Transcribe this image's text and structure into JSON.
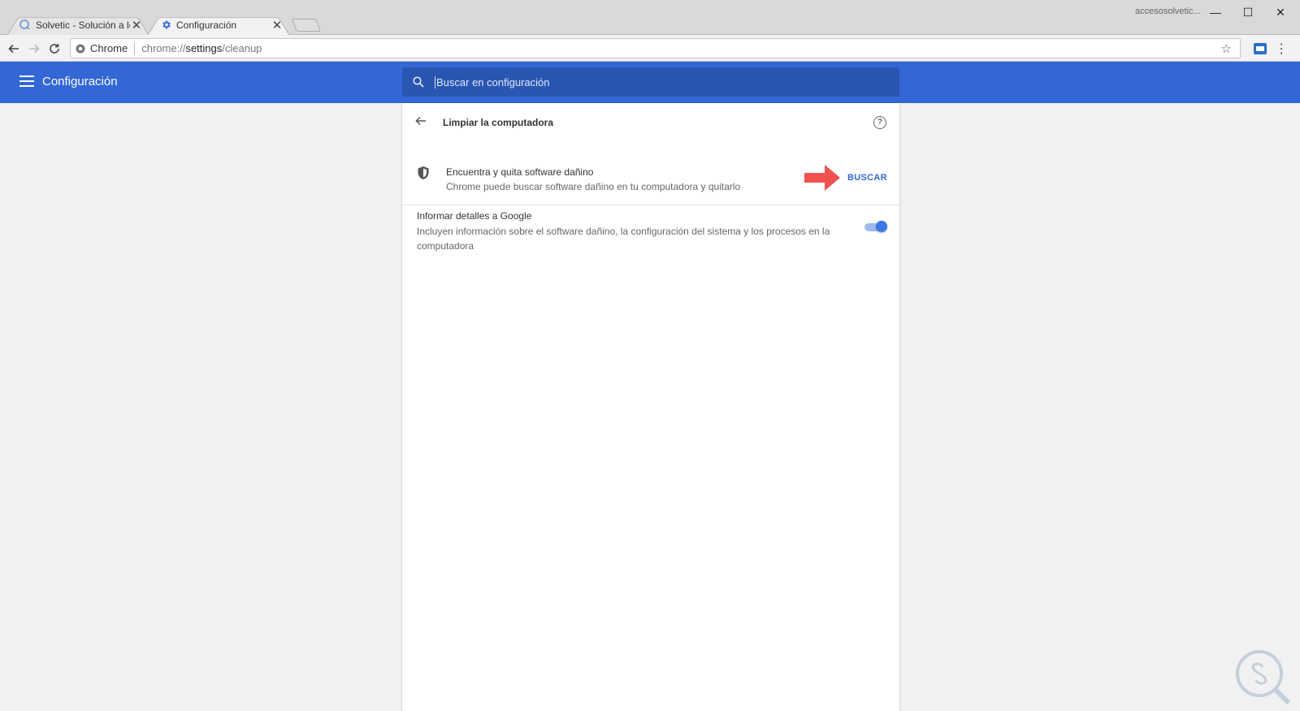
{
  "tabs": [
    {
      "title": "Solvetic - Solución a los p",
      "active": false,
      "favicon": "solvetic-icon"
    },
    {
      "title": "Configuración",
      "active": true,
      "favicon": "gear-icon"
    }
  ],
  "window": {
    "profile": "accesosolvetic..."
  },
  "omnibox": {
    "site_label": "Chrome",
    "url_prefix": "chrome://",
    "url_host": "settings",
    "url_path": "/cleanup"
  },
  "header": {
    "title": "Configuración",
    "search_placeholder": "Buscar en configuración"
  },
  "cleanup": {
    "title": "Limpiar la computadora",
    "scan": {
      "title": "Encuentra y quita software dañino",
      "subtitle": "Chrome puede buscar software dañino en tu computadora y quitarlo",
      "button": "BUSCAR"
    },
    "report": {
      "title": "Informar detalles a Google",
      "subtitle": "Incluyen información sobre el software dañino, la configuración del sistema y los procesos en la computadora",
      "enabled": true
    }
  },
  "colors": {
    "accent": "#3367d6",
    "arrow": "#ef5350"
  }
}
